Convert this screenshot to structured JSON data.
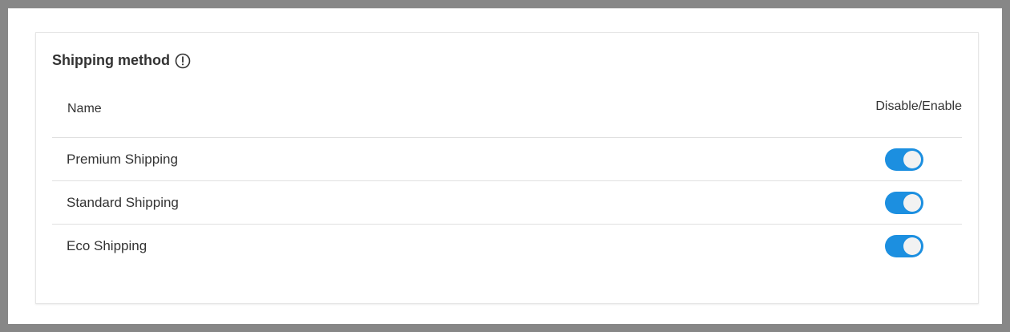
{
  "shipping": {
    "title": "Shipping method",
    "info_icon": "info-circle-icon",
    "columns": {
      "name": "Name",
      "toggle": "Disable/Enable"
    },
    "methods": [
      {
        "name": "Premium Shipping",
        "enabled": true
      },
      {
        "name": "Standard Shipping",
        "enabled": true
      },
      {
        "name": "Eco Shipping",
        "enabled": true
      }
    ]
  },
  "colors": {
    "toggle_on": "#1c8fe0",
    "toggle_knob": "#f2f2f2",
    "backdrop": "#878787",
    "text": "#333333"
  }
}
